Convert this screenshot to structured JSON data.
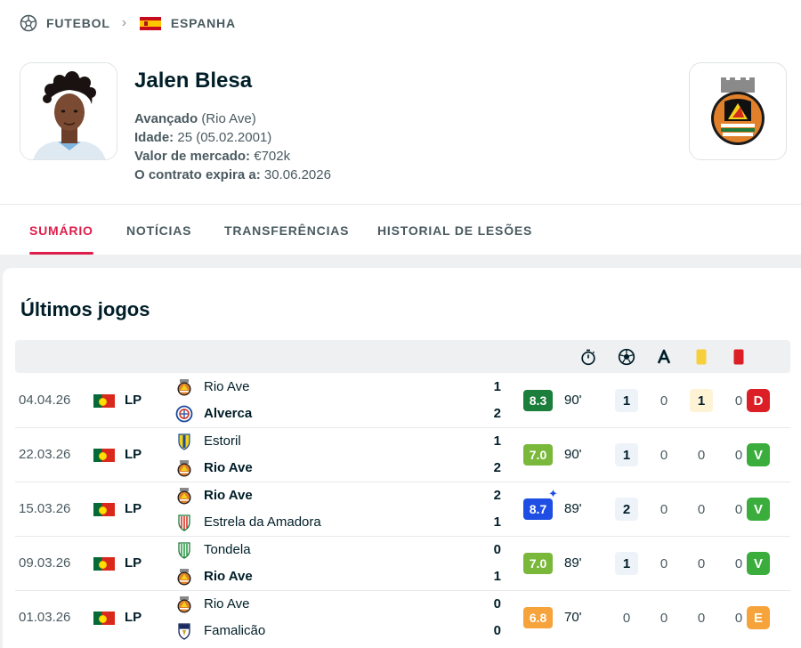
{
  "breadcrumb": {
    "sport": "FUTEBOL",
    "country": "ESPANHA"
  },
  "player": {
    "name": "Jalen Blesa",
    "position_label": "Avançado",
    "team_paren": "(Rio Ave)",
    "age_label": "Idade:",
    "age_value": "25 (05.02.2001)",
    "market_label": "Valor de mercado:",
    "market_value": "€702k",
    "contract_label": "O contrato expira a:",
    "contract_value": "30.06.2026"
  },
  "tabs": [
    {
      "label": "SUMÁRIO",
      "active": true
    },
    {
      "label": "NOTÍCIAS",
      "active": false
    },
    {
      "label": "TRANSFERÊNCIAS",
      "active": false
    },
    {
      "label": "HISTORIAL DE LESÕES",
      "active": false
    }
  ],
  "section_title": "Últimos jogos",
  "header_icons": [
    "stopwatch-icon",
    "football-icon",
    "assist-icon",
    "yellow-card-icon",
    "red-card-icon"
  ],
  "colors": {
    "accent": "#df1d4a",
    "rating_dark_green": "#1b7e3b",
    "rating_green": "#7ab83b",
    "rating_blue": "#1e4ee3",
    "rating_orange": "#f5a33a",
    "result_loss": "#dc1f26",
    "result_win": "#3aad3d",
    "result_draw": "#f5a33a"
  },
  "matches": [
    {
      "date": "04.04.26",
      "competition": "LP",
      "home": "Rio Ave",
      "away": "Alverca",
      "home_score": "1",
      "away_score": "2",
      "home_bold": false,
      "away_bold": true,
      "rating": "8.3",
      "minutes": "90'",
      "goals": "1",
      "assists": "0",
      "yellow": "1",
      "red": "0",
      "result": "D"
    },
    {
      "date": "22.03.26",
      "competition": "LP",
      "home": "Estoril",
      "away": "Rio Ave",
      "home_score": "1",
      "away_score": "2",
      "home_bold": false,
      "away_bold": true,
      "rating": "7.0",
      "minutes": "90'",
      "goals": "1",
      "assists": "0",
      "yellow": "0",
      "red": "0",
      "result": "V"
    },
    {
      "date": "15.03.26",
      "competition": "LP",
      "home": "Rio Ave",
      "away": "Estrela da Amadora",
      "home_score": "2",
      "away_score": "1",
      "home_bold": true,
      "away_bold": false,
      "rating": "8.7",
      "minutes": "89'",
      "goals": "2",
      "assists": "0",
      "yellow": "0",
      "red": "0",
      "result": "V"
    },
    {
      "date": "09.03.26",
      "competition": "LP",
      "home": "Tondela",
      "away": "Rio Ave",
      "home_score": "0",
      "away_score": "1",
      "home_bold": false,
      "away_bold": true,
      "rating": "7.0",
      "minutes": "89'",
      "goals": "1",
      "assists": "0",
      "yellow": "0",
      "red": "0",
      "result": "V"
    },
    {
      "date": "01.03.26",
      "competition": "LP",
      "home": "Rio Ave",
      "away": "Famalicão",
      "home_score": "0",
      "away_score": "0",
      "home_bold": false,
      "away_bold": false,
      "rating": "6.8",
      "minutes": "70'",
      "goals": "0",
      "assists": "0",
      "yellow": "0",
      "red": "0",
      "result": "E"
    }
  ]
}
